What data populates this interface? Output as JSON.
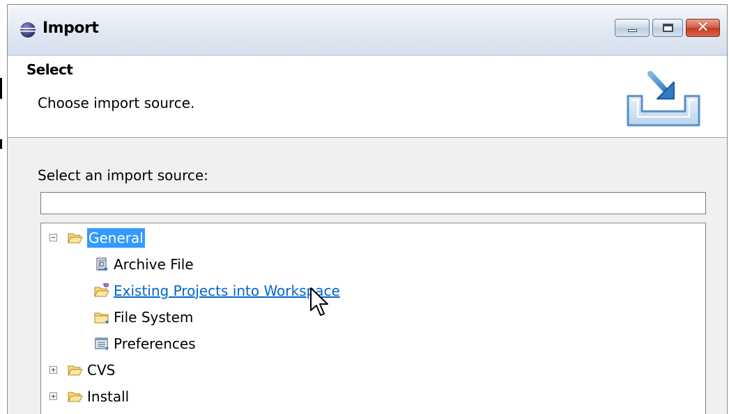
{
  "window": {
    "title": "Import",
    "controls": {
      "minimize": "minimize",
      "maximize": "maximize",
      "close": "close"
    }
  },
  "header": {
    "title": "Select",
    "description": "Choose import source.",
    "banner_icon": "import-wizard-icon"
  },
  "body": {
    "source_label": "Select an import source:",
    "filter": {
      "value": "",
      "placeholder": ""
    },
    "tree": [
      {
        "label": "General",
        "icon": "folder-open-icon",
        "expanded": true,
        "selected": true,
        "children": [
          {
            "label": "Archive File",
            "icon": "archive-file-icon"
          },
          {
            "label": "Existing Projects into Workspace",
            "icon": "existing-projects-icon",
            "hovered": true
          },
          {
            "label": "File System",
            "icon": "folder-icon"
          },
          {
            "label": "Preferences",
            "icon": "preferences-icon"
          }
        ]
      },
      {
        "label": "CVS",
        "icon": "folder-open-icon",
        "expanded": false
      },
      {
        "label": "Install",
        "icon": "folder-open-icon",
        "expanded": false
      }
    ]
  },
  "colors": {
    "selection": "#3399ff",
    "link": "#0066cc",
    "window_bg": "#f0f0f0",
    "close_button": "#c43a22"
  }
}
